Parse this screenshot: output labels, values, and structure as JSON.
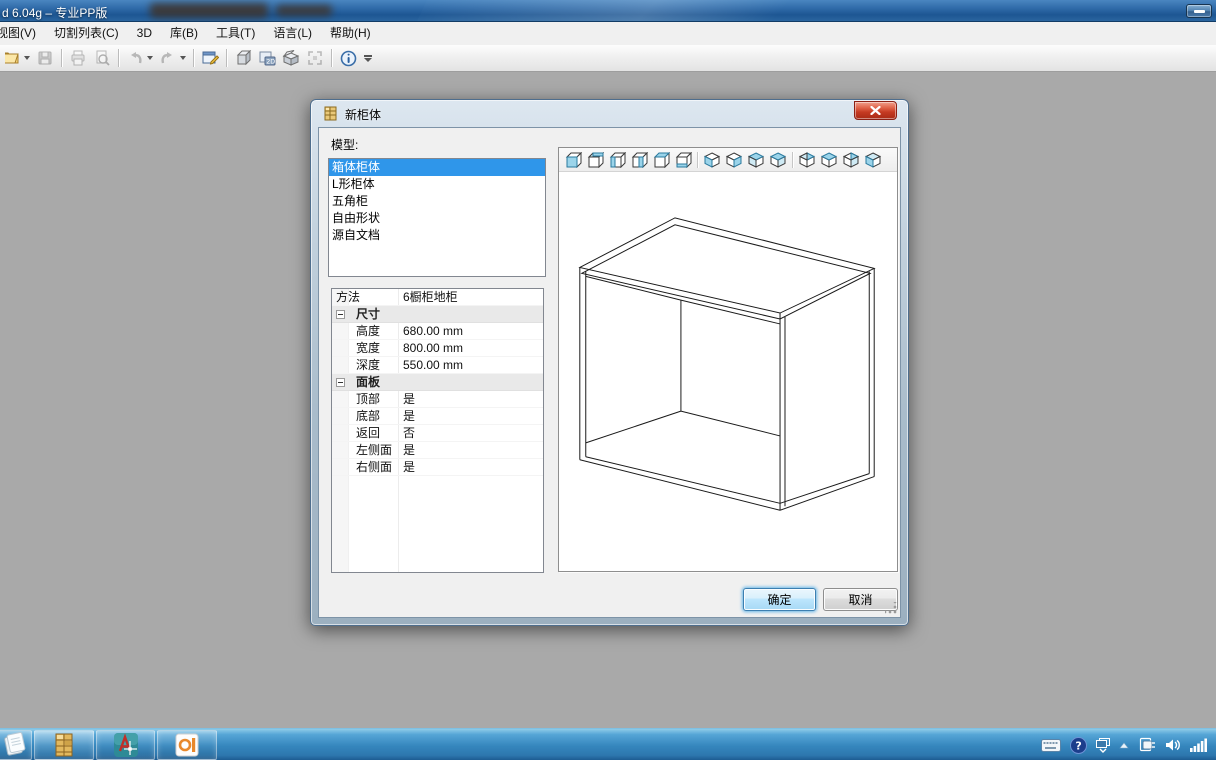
{
  "window": {
    "title": "d 6.04g – 专业PP版"
  },
  "menu_items": [
    "视图(V)",
    "切割列表(C)",
    "3D",
    "库(B)",
    "工具(T)",
    "语言(L)",
    "帮助(H)"
  ],
  "toolbar": {
    "two_d_label": "2D",
    "icons": [
      "open-icon",
      "save-icon",
      "print-icon",
      "print-preview-icon",
      "undo-icon",
      "redo-icon",
      "properties-icon",
      "cube-3d-icon",
      "2d-view-icon",
      "open-box-icon",
      "fit-view-icon",
      "info-icon",
      "toolbar-overflow-icon"
    ]
  },
  "dialog": {
    "title": "新柜体",
    "model_label": "模型:",
    "models": [
      "箱体柜体",
      "L形柜体",
      "五角柜",
      "自由形状",
      "源自文档"
    ],
    "selected_model": "箱体柜体",
    "property_grid": {
      "method": {
        "name": "方法",
        "value": "6橱柜地柜"
      },
      "groups": [
        {
          "label": "尺寸",
          "rows": [
            {
              "name": "高度",
              "value": "680.00 mm"
            },
            {
              "name": "宽度",
              "value": "800.00 mm"
            },
            {
              "name": "深度",
              "value": "550.00 mm"
            }
          ]
        },
        {
          "label": "面板",
          "rows": [
            {
              "name": "顶部",
              "value": "是"
            },
            {
              "name": "底部",
              "value": "是"
            },
            {
              "name": "返回",
              "value": "否"
            },
            {
              "name": "左侧面",
              "value": "是"
            },
            {
              "name": "右侧面",
              "value": "是"
            }
          ]
        }
      ]
    },
    "view_buttons": [
      "cube-front-view",
      "cube-back-view",
      "cube-left-view",
      "cube-right-view",
      "cube-top-view",
      "cube-bottom-view",
      "corner-view-1",
      "corner-view-2",
      "corner-view-3",
      "corner-view-4",
      "corner-view-5",
      "corner-view-6",
      "corner-view-7",
      "corner-view-8"
    ],
    "buttons": {
      "ok": "确定",
      "cancel": "取消"
    }
  },
  "taskbar_items": [
    "journal-app",
    "cabinet-app-active",
    "autocad-app",
    "powerpoint-app"
  ],
  "tray_icons": [
    "keyboard-icon",
    "help-icon",
    "window-restore-icon",
    "show-hidden-icons-icon",
    "plug-icon",
    "volume-icon",
    "network-signal-icon"
  ],
  "colors": {
    "selection": "#2f96ea",
    "titlebar_blue": "#2f6aa8",
    "cube_face_blue": "#9bd4ea",
    "close_red": "#c43a22"
  }
}
